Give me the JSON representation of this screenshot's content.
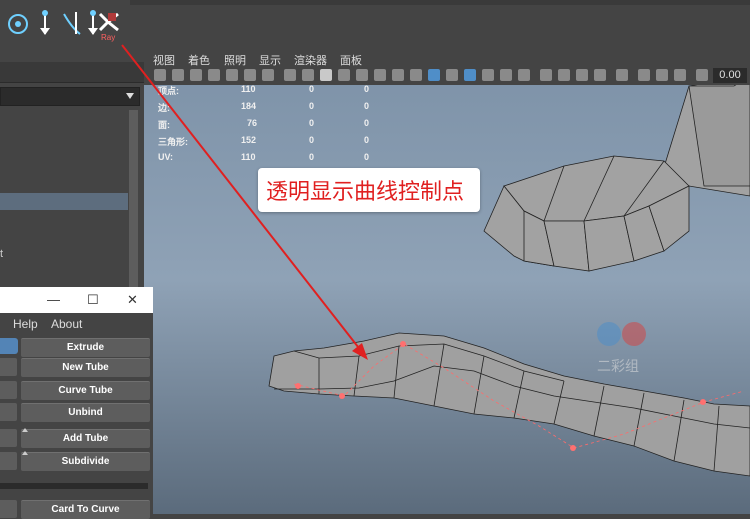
{
  "shelf": {
    "icons": [
      "curve-circle-icon",
      "move-pivot-icon",
      "split-curve-icon",
      "extend-curve-icon",
      "xray-icon"
    ],
    "xray_label": "Ray"
  },
  "viewport_menu": [
    "视图",
    "着色",
    "照明",
    "显示",
    "渲染器",
    "面板"
  ],
  "toolbar": {
    "numeric_value": "0.00"
  },
  "stats": {
    "rows": [
      {
        "label": "顶点:",
        "v1": "110",
        "v2": "0",
        "v3": "0"
      },
      {
        "label": "边:",
        "v1": "184",
        "v2": "0",
        "v3": "0"
      },
      {
        "label": "面:",
        "v1": "76",
        "v2": "0",
        "v3": "0"
      },
      {
        "label": "三角形:",
        "v1": "152",
        "v2": "0",
        "v3": "0"
      },
      {
        "label": "UV:",
        "v1": "110",
        "v2": "0",
        "v3": "0"
      }
    ]
  },
  "callout": {
    "text": "透明显示曲线控制点"
  },
  "watermark": {
    "text": "二彩组"
  },
  "left_panel": {
    "partial_text": "t"
  },
  "plugin": {
    "menu": [
      "Help",
      "About"
    ],
    "buttons": [
      "Extrude",
      "New Tube",
      "Curve Tube",
      "Unbind",
      "Add Tube",
      "Subdivide",
      "Card To Curve"
    ]
  },
  "colors": {
    "accent": "#e02020",
    "arrow": "#e02020",
    "selected": "#5384b6"
  }
}
